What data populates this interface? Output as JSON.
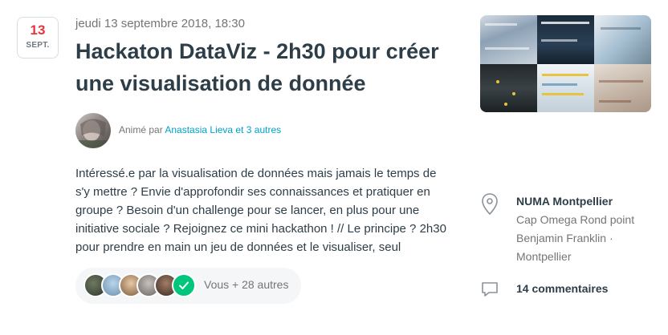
{
  "event": {
    "date_badge": {
      "day": "13",
      "month": "SEPT."
    },
    "datetime": "jeudi 13 septembre 2018, 18:30",
    "title": "Hackaton DataViz - 2h30 pour créer une visualisation de donnée",
    "hosted_prefix": "Animé par",
    "hosted_link": "Anastasia Lieva et 3 autres",
    "description": "Intéressé.e par la visualisation de données mais jamais le temps de s'y mettre ? Envie d'approfondir ses connaissances et pratiquer en groupe ? Besoin d'un challenge pour se lancer, en plus pour une initiative sociale ? Rejoignez ce mini hackathon ! // Le principe ? 2h30 pour prendre en main un jeu de données et le visualiser, seul",
    "attendees_label": "Vous + 28 autres"
  },
  "venue": {
    "name": "NUMA Montpellier",
    "address": "Cap Omega Rond point Benjamin Franklin · Montpellier"
  },
  "comments_label": "14 commentaires",
  "colors": {
    "date_red": "#e2373f",
    "link_blue": "#00a2c7",
    "check_green": "#00c67d",
    "text_dark": "#2e3e48",
    "text_muted": "#757575"
  },
  "icons": {
    "location": "location-pin-icon",
    "comments": "speech-bubble-icon",
    "attending": "checkmark-icon"
  }
}
